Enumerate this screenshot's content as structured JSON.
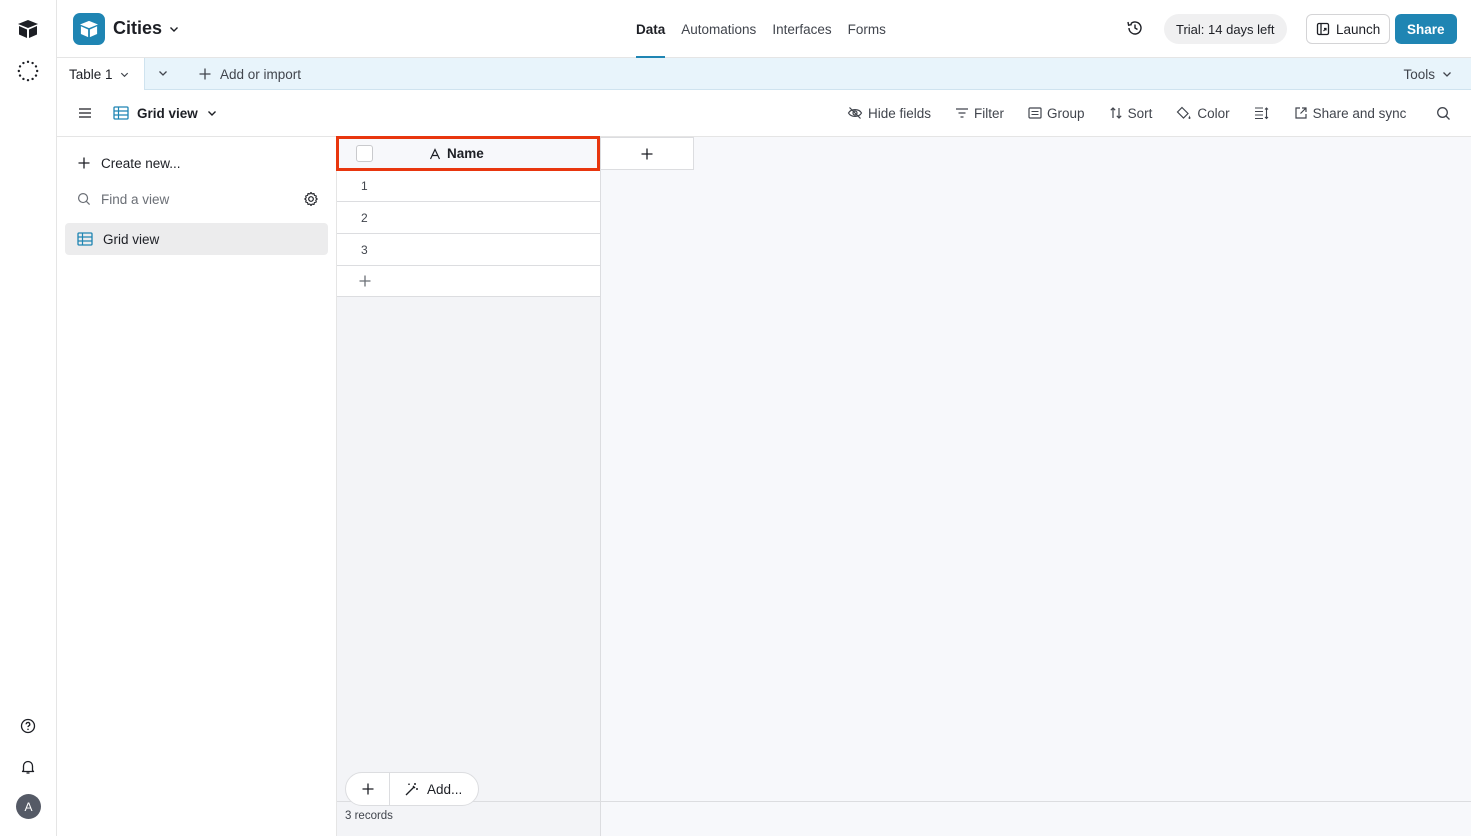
{
  "base": {
    "name": "Cities",
    "color": "#1f85b3"
  },
  "top_tabs": [
    {
      "label": "Data",
      "active": true
    },
    {
      "label": "Automations",
      "active": false
    },
    {
      "label": "Interfaces",
      "active": false
    },
    {
      "label": "Forms",
      "active": false
    }
  ],
  "header": {
    "trial_label": "Trial: 14 days left",
    "launch_label": "Launch",
    "share_label": "Share"
  },
  "table_bar": {
    "table_name": "Table 1",
    "add_import_label": "Add or import",
    "tools_label": "Tools"
  },
  "view_bar": {
    "view_name": "Grid view",
    "actions": {
      "hide_fields": "Hide fields",
      "filter": "Filter",
      "group": "Group",
      "sort": "Sort",
      "color": "Color",
      "share_sync": "Share and sync"
    }
  },
  "sidebar": {
    "create_new_label": "Create new...",
    "find_placeholder": "Find a view",
    "views": [
      {
        "label": "Grid view",
        "selected": true
      }
    ]
  },
  "grid": {
    "primary_field": "Name",
    "rows": [
      {
        "num": "1",
        "name": ""
      },
      {
        "num": "2",
        "name": ""
      },
      {
        "num": "3",
        "name": ""
      }
    ],
    "add_label": "Add...",
    "record_count": "3 records"
  },
  "user": {
    "avatar_initial": "A"
  }
}
